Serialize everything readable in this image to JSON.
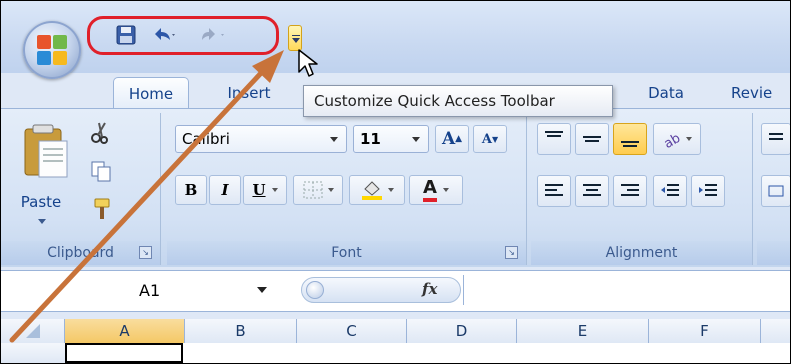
{
  "quick_access": {
    "customize_tooltip": "Customize Quick Access Toolbar"
  },
  "tabs": [
    "Home",
    "Insert",
    "Data",
    "Revie"
  ],
  "clipboard": {
    "paste_label": "Paste",
    "group_label": "Clipboard"
  },
  "font": {
    "font_name": "Calibri",
    "font_size": "11",
    "group_label": "Font",
    "bold": "B",
    "italic": "I",
    "underline": "U",
    "grow": "A",
    "shrink": "A",
    "font_color_letter": "A"
  },
  "alignment": {
    "group_label": "Alignment"
  },
  "formula_bar": {
    "name_box": "A1",
    "fx": "fx"
  },
  "columns": [
    "A",
    "B",
    "C",
    "D",
    "E",
    "F"
  ],
  "colors": {
    "highlight_red": "#e0202a",
    "arrow_orange": "#c8733a",
    "ribbon_text": "#15428b"
  }
}
